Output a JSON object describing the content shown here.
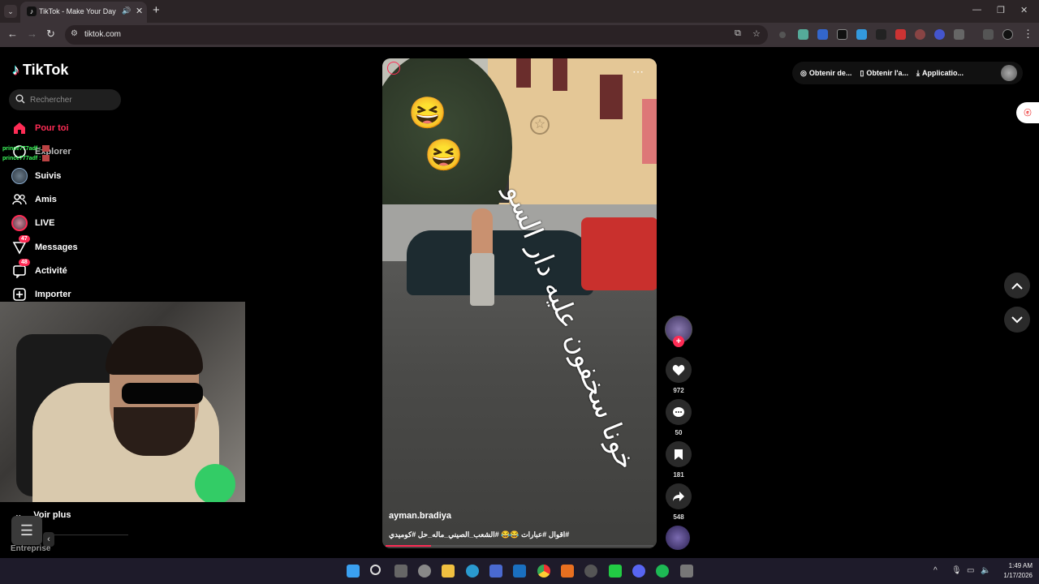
{
  "browser": {
    "tab_title": "TikTok - Make Your Day",
    "url": "tiktok.com"
  },
  "sidebar": {
    "logo": "TikTok",
    "search_placeholder": "Rechercher",
    "items": [
      {
        "label": "Pour toi",
        "icon": "home-icon",
        "active": true
      },
      {
        "label": "Explorer",
        "icon": "compass-icon"
      },
      {
        "label": "Suivis",
        "icon": "avatar-icon"
      },
      {
        "label": "Amis",
        "icon": "friends-icon"
      },
      {
        "label": "LIVE",
        "icon": "live-icon"
      },
      {
        "label": "Messages",
        "icon": "messages-icon",
        "badge": "47"
      },
      {
        "label": "Activité",
        "icon": "activity-icon",
        "badge": "48"
      },
      {
        "label": "Importer",
        "icon": "upload-icon"
      }
    ],
    "voir_plus": "Voir plus",
    "entreprise": "Entreprise"
  },
  "chat_overlay": [
    "prince777adf :",
    "prince777adf :"
  ],
  "video": {
    "author": "ayman.bradiya",
    "caption": "#اقوال #عبارات 😂😂 #الشعب_الصيني_ماله_حل #كوميدي",
    "overlay_text": "خونا سخفون عليه دار السو",
    "progress": 0.17
  },
  "actions": {
    "likes": "972",
    "comments": "50",
    "saves": "181",
    "shares": "548"
  },
  "top_bar": {
    "coins": "Obtenir de...",
    "app": "Obtenir l'a...",
    "desktop": "Applicatio..."
  },
  "clock": {
    "time": "1:49 AM",
    "date": "1/17/2026"
  },
  "colors": {
    "accent": "#fe2c55",
    "browser_chrome": "#3b3337"
  }
}
